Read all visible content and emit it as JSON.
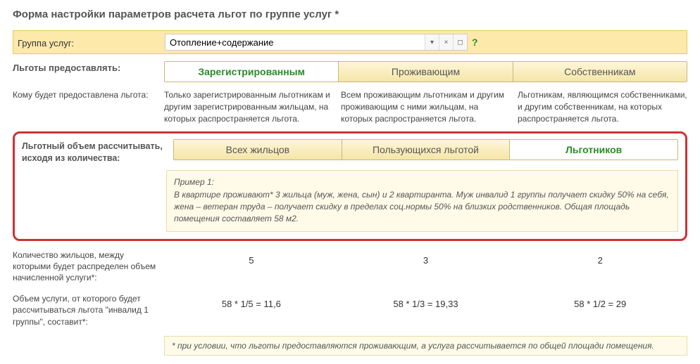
{
  "title": "Форма настройки параметров расчета льгот по группе услуг *",
  "group": {
    "label": "Группа услуг:",
    "value": "Отопление+содержание"
  },
  "provide": {
    "label": "Льготы предоставлять:",
    "tabs": [
      "Зарегистрированным",
      "Проживающим",
      "Собственникам"
    ],
    "selected": 0
  },
  "who": {
    "label": "Кому будет предоставлена льгота:",
    "descriptions": [
      "Только зарегистрированным льготникам и другим зарегистрированным жильцам, на которых распространяется льгота.",
      "Всем проживающим льготникам и другим проживающим с ними жильцам, на которых распространяется льгота.",
      "Льготникам, являющимся собственниками, и другим собственникам, на которых распространяется льгота."
    ]
  },
  "volume": {
    "label": "Льготный объем рассчитывать, исходя из количества:",
    "tabs": [
      "Всех жильцов",
      "Пользующихся льготой",
      "Льготников"
    ],
    "selected": 2
  },
  "example": {
    "title": "Пример 1:",
    "text": "В квартире проживают* 3 жильца (муж, жена, сын) и 2 квартиранта. Муж инвалид 1 группы получает скидку 50% на себя, жена – ветеран труда – получает скидку в пределах соц.нормы 50% на близких родственников. Общая площадь помещения составляет 58 м2."
  },
  "residents": {
    "label": "Количество жильцов, между которыми будет распределен объем начисленной услуги*:",
    "values": [
      "5",
      "3",
      "2"
    ]
  },
  "calc": {
    "label": "Объем услуги, от которого будет рассчитываться льгота \"инвалид 1 группы\", составит*:",
    "values": [
      "58 * 1/5 = 11,6",
      "58 * 1/3 = 19,33",
      "58 * 1/2 = 29"
    ]
  },
  "footnote": "* при условии, что льготы предоставляются проживающим, а услуга рассчитывается по общей площади помещения."
}
